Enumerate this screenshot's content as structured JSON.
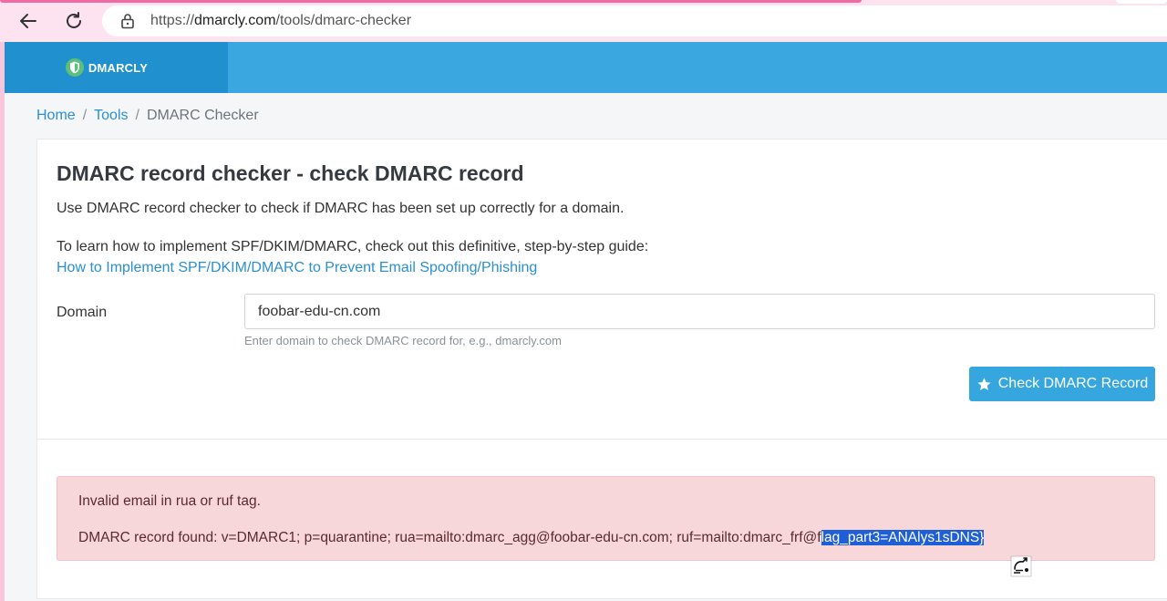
{
  "browser": {
    "url_scheme": "https://",
    "url_host": "dmarcly.com",
    "url_path": "/tools/dmarc-checker",
    "icons": [
      "back-arrow-icon",
      "reload-icon",
      "site-info-icon"
    ]
  },
  "site": {
    "logo_text": "DMARCLY",
    "header_color": "#3aa7e0",
    "logo_bg_color": "#2190cf"
  },
  "breadcrumb": {
    "home": "Home",
    "tools": "Tools",
    "current": "DMARC Checker",
    "separator": "/"
  },
  "main": {
    "title": "DMARC record checker - check DMARC record",
    "intro": "Use DMARC record checker to check if DMARC has been set up correctly for a domain.",
    "guide_text": "To learn how to implement SPF/DKIM/DMARC, check out this definitive, step-by-step guide:",
    "guide_link": "How to Implement SPF/DKIM/DMARC to Prevent Email Spoofing/Phishing",
    "domain_label": "Domain",
    "domain_value": "foobar-edu-cn.com",
    "domain_help": "Enter domain to check DMARC record for, e.g., dmarcly.com",
    "check_button": "Check DMARC Record",
    "check_button_icon": "star-icon"
  },
  "result": {
    "error": "Invalid email in rua or ruf tag.",
    "record_prefix": "DMARC record found: v=DMARC1; p=quarantine; rua=mailto:dmarc_agg@foobar-edu-cn.com; ruf=mailto:dmarc_frf@f",
    "record_selected": "lag_part3=ANAlys1sDNS}",
    "alert_bg_color": "#f8d7da",
    "selection_color": "#1e5fd6"
  }
}
